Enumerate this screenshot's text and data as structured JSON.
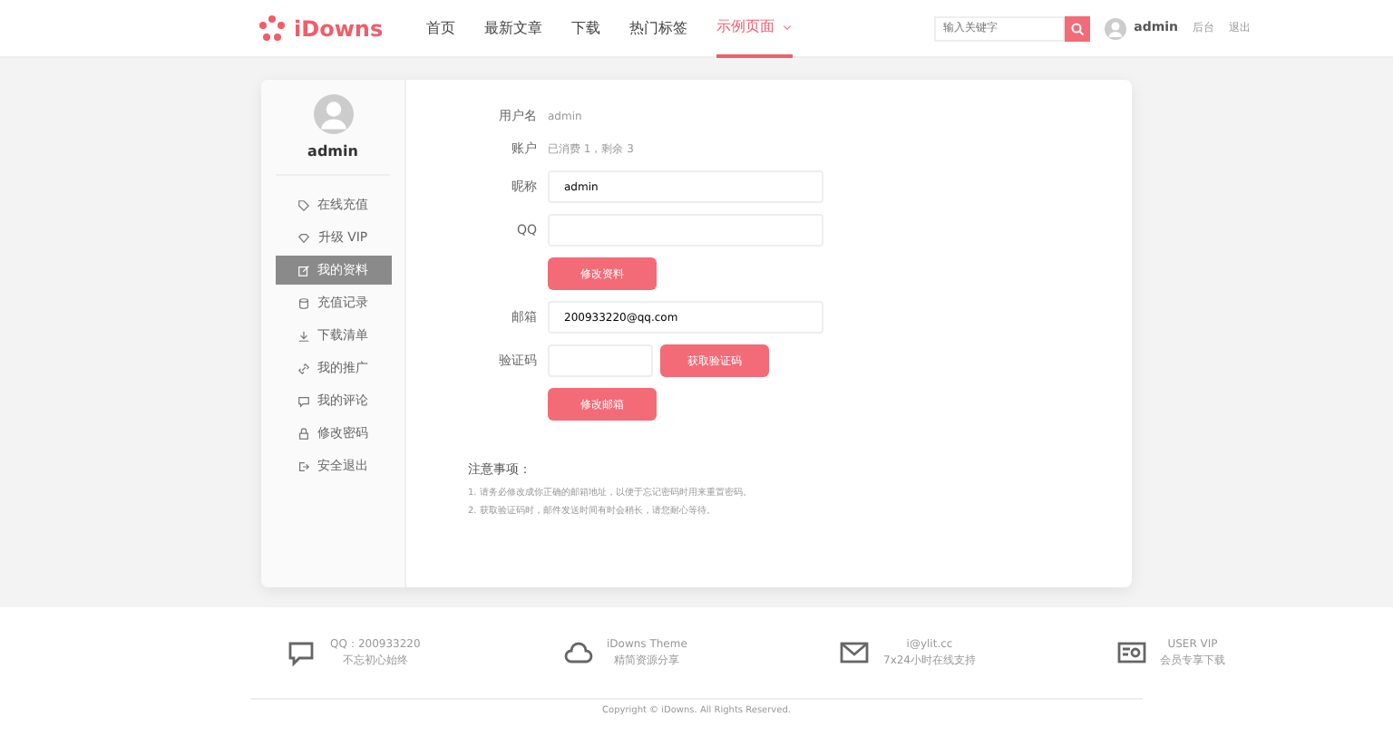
{
  "header": {
    "logo": "iDowns",
    "nav": [
      {
        "label": "首页",
        "selected": false,
        "dropdown": false
      },
      {
        "label": "最新文章",
        "selected": false,
        "dropdown": false
      },
      {
        "label": "下载",
        "selected": false,
        "dropdown": false
      },
      {
        "label": "热门标签",
        "selected": false,
        "dropdown": false
      },
      {
        "label": "示例页面",
        "selected": true,
        "dropdown": true
      }
    ],
    "search": {
      "placeholder": "输入关键字"
    },
    "user": "admin",
    "links": [
      "后台",
      "退出"
    ]
  },
  "sidebar": {
    "username": "admin",
    "items": [
      {
        "label": "在线充值",
        "selected": false
      },
      {
        "label": "升级 VIP",
        "selected": false
      },
      {
        "label": "我的资料",
        "selected": true
      },
      {
        "label": "充值记录",
        "selected": false
      },
      {
        "label": "下载清单",
        "selected": false
      },
      {
        "label": "我的推广",
        "selected": false
      },
      {
        "label": "我的评论",
        "selected": false
      },
      {
        "label": "修改密码",
        "selected": false
      },
      {
        "label": "安全退出",
        "selected": false
      }
    ]
  },
  "form": {
    "rows": [
      {
        "kind": "text",
        "label": "用户名",
        "value": "admin"
      },
      {
        "kind": "text",
        "label": "账户",
        "value": "已消费 1，剩余 3"
      },
      {
        "kind": "field",
        "label": "昵称",
        "value": "admin"
      },
      {
        "kind": "field",
        "label": "QQ"
      },
      {
        "kind": "button",
        "label": "修改资料"
      },
      {
        "kind": "field",
        "label": "邮箱",
        "value": "200933220@qq.com"
      },
      {
        "kind": "code",
        "label": "验证码",
        "button": "获取验证码"
      },
      {
        "kind": "button",
        "label": "修改邮箱"
      }
    ],
    "notes_title": "注意事项：",
    "notes": [
      "1. 请务必修改成你正确的邮箱地址，以便于忘记密码时用来重置密码。",
      "2. 获取验证码时，邮件发送时间有时会稍长，请您耐心等待。"
    ]
  },
  "footer": {
    "items": [
      {
        "title": "QQ：200933220",
        "subtitle": "不忘初心始终"
      },
      {
        "title": "iDowns Theme",
        "subtitle": "精简资源分享"
      },
      {
        "title": "i@ylit.cc",
        "subtitle": "7x24小时在线支持"
      },
      {
        "title": "USER VIP",
        "subtitle": "会员专享下载"
      }
    ],
    "copyright": "Copyright © iDowns. All Rights Reserved."
  }
}
